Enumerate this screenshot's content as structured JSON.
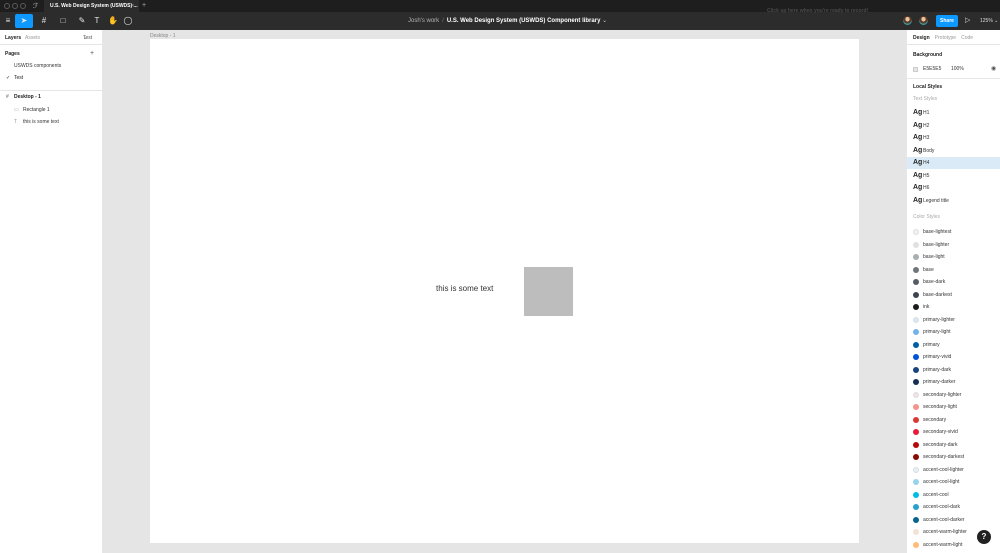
{
  "titlebar": {
    "doc_tab_title": "U.S. Web Design System (USWDS) ...",
    "tab_close": "×",
    "new_tab": "+"
  },
  "toolbar": {
    "menu_icon": "≡",
    "move_tool": "➤",
    "frame_tool": "#",
    "shape_tool": "□",
    "pen_tool": "✎",
    "text_tool": "T",
    "hand_tool": "✋",
    "comment_tool": "◯",
    "team": "Josh's work",
    "separator": "/",
    "file_name": "U.S. Web Design System (USWDS) Component library",
    "record_hint": "Click up here when you're ready to record!",
    "share_label": "Share",
    "play_icon": "▷",
    "zoom": "125%"
  },
  "left_panel": {
    "tabs": [
      "Layers",
      "Assets"
    ],
    "page_selector": "Test",
    "pages_heading": "Pages",
    "add_page": "+",
    "pages": [
      {
        "label": "USWDS components",
        "current": false
      },
      {
        "label": "Test",
        "current": true
      }
    ],
    "check": "✓",
    "layers": [
      {
        "icon": "#",
        "label": "Desktop - 1",
        "level": 0
      },
      {
        "icon": "▭",
        "label": "Rectangle 1",
        "level": 1
      },
      {
        "icon": "T",
        "label": "this is some text",
        "level": 1
      }
    ]
  },
  "canvas": {
    "frame_label": "Desktop - 1",
    "text_layer": "this is some text"
  },
  "right_panel": {
    "tabs": [
      "Design",
      "Prototype",
      "Code"
    ],
    "background_heading": "Background",
    "background_hex": "E5E5E5",
    "background_opacity": "100%",
    "eye_icon": "◉",
    "local_styles_heading": "Local Styles",
    "text_styles_heading": "Text Styles",
    "ag": "Ag",
    "text_styles": [
      {
        "label": "H1",
        "selected": false
      },
      {
        "label": "H2",
        "selected": false
      },
      {
        "label": "H3",
        "selected": false
      },
      {
        "label": "Body",
        "selected": false
      },
      {
        "label": "H4",
        "selected": true
      },
      {
        "label": "H5",
        "selected": false
      },
      {
        "label": "H6",
        "selected": false
      },
      {
        "label": "Legend title",
        "selected": false
      }
    ],
    "color_styles_heading": "Color Styles",
    "color_styles": [
      {
        "label": "base-lightest",
        "color": "#f0f0f0"
      },
      {
        "label": "base-lighter",
        "color": "#dfe1e2"
      },
      {
        "label": "base-light",
        "color": "#a9aeb1"
      },
      {
        "label": "base",
        "color": "#71767a"
      },
      {
        "label": "base-dark",
        "color": "#565c65"
      },
      {
        "label": "base-darkest",
        "color": "#3d4551"
      },
      {
        "label": "ink",
        "color": "#1b1b1b"
      },
      {
        "label": "primary-lighter",
        "color": "#d9e8f6"
      },
      {
        "label": "primary-light",
        "color": "#73b3e7"
      },
      {
        "label": "primary",
        "color": "#005ea2"
      },
      {
        "label": "primary-vivid",
        "color": "#0050d8"
      },
      {
        "label": "primary-dark",
        "color": "#1a4480"
      },
      {
        "label": "primary-darker",
        "color": "#162e51"
      },
      {
        "label": "secondary-lighter",
        "color": "#f3e1e4"
      },
      {
        "label": "secondary-light",
        "color": "#f2938c"
      },
      {
        "label": "secondary",
        "color": "#d83933"
      },
      {
        "label": "secondary-vivid",
        "color": "#e41d3d"
      },
      {
        "label": "secondary-dark",
        "color": "#b50909"
      },
      {
        "label": "secondary-darkest",
        "color": "#8b0a03"
      },
      {
        "label": "accent-cool-lighter",
        "color": "#e1f3f8"
      },
      {
        "label": "accent-cool-light",
        "color": "#97d4ea"
      },
      {
        "label": "accent-cool",
        "color": "#00bde3"
      },
      {
        "label": "accent-cool-dark",
        "color": "#28a0cb"
      },
      {
        "label": "accent-cool-darker",
        "color": "#07648d"
      },
      {
        "label": "accent-warm-lighter",
        "color": "#f2e4d4"
      },
      {
        "label": "accent-warm-light",
        "color": "#ffbc78"
      }
    ],
    "help": "?"
  }
}
